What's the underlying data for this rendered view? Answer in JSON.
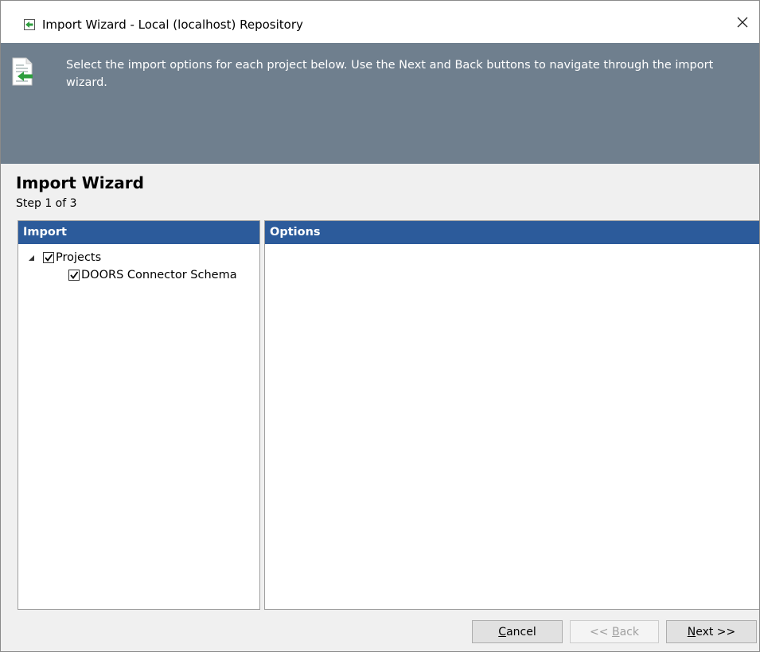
{
  "window": {
    "title": "Import Wizard - Local  (localhost) Repository",
    "close_glyph": "✕"
  },
  "banner": {
    "text": "Select the import options for each project below. Use the Next and Back buttons to navigate through the import wizard."
  },
  "wizard": {
    "title": "Import Wizard",
    "step": "Step 1 of 3"
  },
  "import_panel": {
    "header": "Import",
    "tree": [
      {
        "label": "Projects",
        "checked": true,
        "expanded": true
      },
      {
        "label": "DOORS Connector Schema",
        "checked": true
      }
    ]
  },
  "options_panel": {
    "header": "Options"
  },
  "buttons": {
    "cancel": {
      "mnemonic": "C",
      "rest": "ancel"
    },
    "back": {
      "prefix": "<< ",
      "mnemonic": "B",
      "rest": "ack",
      "enabled": false
    },
    "next": {
      "mnemonic": "N",
      "rest": "ext >>"
    }
  },
  "colors": {
    "banner_bg": "#6f7f8e",
    "panel_header_bg": "#2c5b9b",
    "icon_green": "#2e9e3e"
  }
}
